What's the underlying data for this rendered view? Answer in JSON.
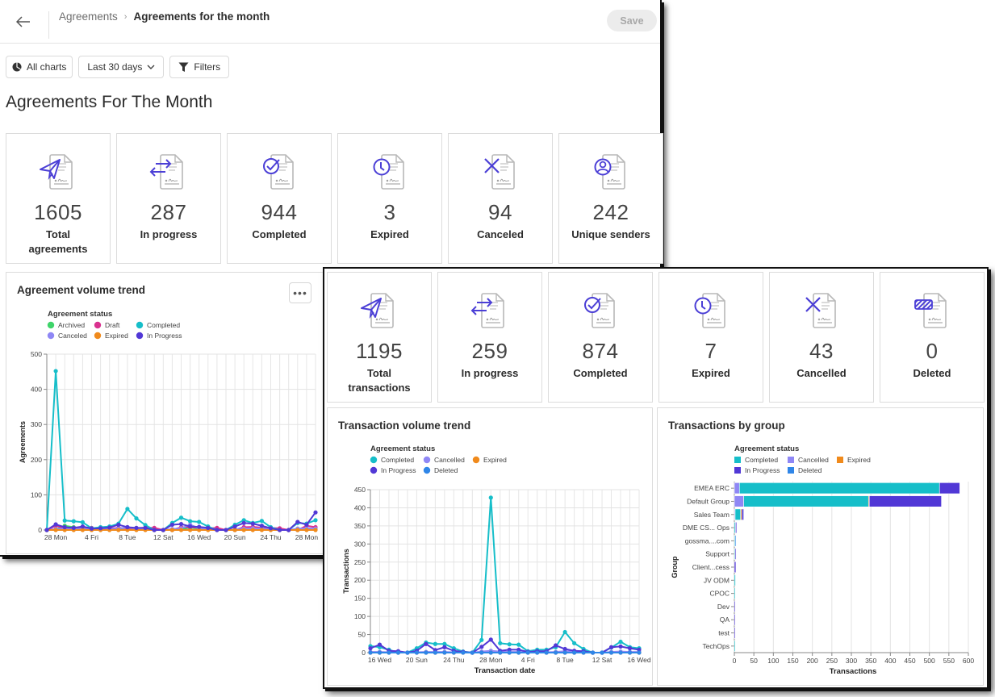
{
  "back_window": {
    "header": {
      "back_icon": "arrow-left-icon",
      "breadcrumb": {
        "parent": "Agreements",
        "separator": ">",
        "current": "Agreements for the month"
      },
      "save_label": "Save"
    },
    "toolbar": {
      "all_charts_label": "All charts",
      "all_charts_icon": "pie-chart-icon",
      "date_range": "Last 30 days",
      "filters_label": "Filters",
      "filters_icon": "funnel-icon"
    },
    "page_title": "Agreements For The Month",
    "stats": [
      {
        "icon": "paper-plane",
        "value": "1605",
        "label": "Total agreements"
      },
      {
        "icon": "arrows-exchange",
        "value": "287",
        "label": "In progress"
      },
      {
        "icon": "check-circle",
        "value": "944",
        "label": "Completed"
      },
      {
        "icon": "clock",
        "value": "3",
        "label": "Expired"
      },
      {
        "icon": "x-mark",
        "value": "94",
        "label": "Canceled"
      },
      {
        "icon": "user-circle",
        "value": "242",
        "label": "Unique senders"
      }
    ],
    "volume_trend": {
      "title": "Agreement volume trend",
      "more_label": "•••"
    }
  },
  "front_window": {
    "stats": [
      {
        "icon": "paper-plane",
        "value": "1195",
        "label": "Total transactions"
      },
      {
        "icon": "arrows-exchange",
        "value": "259",
        "label": "In progress"
      },
      {
        "icon": "check-circle",
        "value": "874",
        "label": "Completed"
      },
      {
        "icon": "clock",
        "value": "7",
        "label": "Expired"
      },
      {
        "icon": "x-mark",
        "value": "43",
        "label": "Cancelled"
      },
      {
        "icon": "striped-tag",
        "value": "0",
        "label": "Deleted"
      }
    ],
    "transaction_trend": {
      "title": "Transaction volume trend"
    },
    "by_group": {
      "title": "Transactions by group"
    }
  },
  "colors": {
    "accent_icon": "#4b3fd6",
    "completed": "#16bec9",
    "archived": "#3fd46a",
    "draft": "#d9318f",
    "canceled": "#8f87f5",
    "expired": "#f08a1c",
    "in_progress": "#5138d6",
    "deleted": "#2f86e8"
  },
  "chart_data": [
    {
      "id": "agreement-volume-trend",
      "type": "line",
      "title": "Agreement volume trend",
      "legend_title": "Agreement status",
      "legend_position": "top-left",
      "xlabel": "",
      "ylabel": "Agreements",
      "ylim": [
        0,
        500
      ],
      "yticks": [
        0,
        100,
        200,
        300,
        400,
        500
      ],
      "grid": true,
      "x_tick_labels": [
        {
          "index": 1,
          "label": "28 Mon"
        },
        {
          "index": 5,
          "label": "4 Fri"
        },
        {
          "index": 9,
          "label": "8 Tue"
        },
        {
          "index": 13,
          "label": "12 Sat"
        },
        {
          "index": 17,
          "label": "16 Wed"
        },
        {
          "index": 21,
          "label": "20 Sun"
        },
        {
          "index": 25,
          "label": "24 Thu"
        },
        {
          "index": 29,
          "label": "28 Mon"
        }
      ],
      "n_points": 31,
      "series": [
        {
          "name": "Archived",
          "color_key": "archived",
          "values": [
            0,
            2,
            12,
            8,
            5,
            3,
            2,
            3,
            4,
            6,
            4,
            5,
            3,
            0,
            0,
            3,
            6,
            4,
            3,
            3,
            0,
            0,
            3,
            4,
            3,
            4,
            3,
            0,
            0,
            3,
            2
          ]
        },
        {
          "name": "Draft",
          "color_key": "draft",
          "values": [
            0,
            12,
            5,
            6,
            8,
            6,
            4,
            4,
            6,
            5,
            5,
            7,
            6,
            0,
            0,
            8,
            8,
            6,
            5,
            6,
            0,
            0,
            8,
            9,
            7,
            6,
            5,
            0,
            0,
            12,
            8
          ]
        },
        {
          "name": "Completed",
          "color_key": "completed",
          "values": [
            0,
            452,
            27,
            25,
            22,
            5,
            8,
            10,
            18,
            60,
            33,
            14,
            0,
            0,
            20,
            35,
            25,
            23,
            10,
            0,
            0,
            15,
            28,
            20,
            26,
            8,
            0,
            0,
            20,
            18,
            28
          ]
        },
        {
          "name": "Canceled",
          "color_key": "canceled",
          "values": [
            0,
            3,
            4,
            3,
            3,
            2,
            3,
            3,
            4,
            8,
            4,
            3,
            0,
            0,
            3,
            5,
            15,
            5,
            3,
            0,
            0,
            2,
            4,
            5,
            4,
            2,
            0,
            0,
            4,
            5,
            4
          ]
        },
        {
          "name": "Expired",
          "color_key": "expired",
          "values": [
            0,
            0,
            0,
            0,
            0,
            0,
            0,
            0,
            0,
            0,
            0,
            0,
            0,
            0,
            0,
            0,
            0,
            0,
            0,
            0,
            0,
            0,
            0,
            0,
            0,
            0,
            0,
            0,
            0,
            0,
            0
          ]
        },
        {
          "name": "In Progress",
          "color_key": "in_progress",
          "values": [
            0,
            16,
            8,
            6,
            10,
            4,
            5,
            7,
            15,
            8,
            6,
            6,
            0,
            0,
            15,
            17,
            10,
            9,
            6,
            0,
            0,
            10,
            20,
            18,
            12,
            5,
            0,
            0,
            23,
            15,
            50
          ]
        }
      ]
    },
    {
      "id": "transaction-volume-trend",
      "type": "line",
      "title": "Transaction volume trend",
      "legend_title": "Agreement status",
      "legend_position": "top-left",
      "xlabel": "Transaction date",
      "ylabel": "Transactions",
      "ylim": [
        0,
        450
      ],
      "yticks": [
        0,
        50,
        100,
        150,
        200,
        250,
        300,
        350,
        400,
        450
      ],
      "grid": true,
      "x_tick_labels": [
        {
          "index": 1,
          "label": "16 Wed"
        },
        {
          "index": 5,
          "label": "20 Sun"
        },
        {
          "index": 9,
          "label": "24 Thu"
        },
        {
          "index": 13,
          "label": "28 Mon"
        },
        {
          "index": 17,
          "label": "4 Fri"
        },
        {
          "index": 21,
          "label": "8 Tue"
        },
        {
          "index": 25,
          "label": "12 Sat"
        },
        {
          "index": 29,
          "label": "16 Wed"
        }
      ],
      "n_points": 30,
      "series": [
        {
          "name": "Completed",
          "color_key": "completed",
          "values": [
            18,
            15,
            8,
            0,
            0,
            12,
            28,
            24,
            24,
            12,
            3,
            0,
            35,
            428,
            26,
            23,
            22,
            4,
            8,
            8,
            15,
            57,
            26,
            10,
            0,
            0,
            14,
            30,
            15,
            12
          ]
        },
        {
          "name": "Cancelled",
          "color_key": "canceled",
          "values": [
            2,
            2,
            1,
            1,
            0,
            1,
            2,
            2,
            2,
            1,
            1,
            0,
            3,
            5,
            3,
            2,
            2,
            1,
            1,
            1,
            2,
            4,
            3,
            1,
            0,
            0,
            2,
            3,
            2,
            2
          ]
        },
        {
          "name": "Expired",
          "color_key": "expired",
          "values": [
            0,
            0,
            0,
            0,
            0,
            0,
            0,
            0,
            0,
            0,
            0,
            0,
            0,
            0,
            0,
            0,
            0,
            0,
            0,
            0,
            0,
            0,
            0,
            0,
            0,
            0,
            0,
            0,
            0,
            0
          ]
        },
        {
          "name": "In Progress",
          "color_key": "in_progress",
          "values": [
            12,
            22,
            5,
            4,
            0,
            5,
            24,
            7,
            15,
            5,
            2,
            0,
            16,
            36,
            5,
            8,
            8,
            2,
            4,
            4,
            20,
            10,
            5,
            4,
            0,
            0,
            15,
            17,
            12,
            8
          ]
        },
        {
          "name": "Deleted",
          "color_key": "deleted",
          "values": [
            0,
            0,
            0,
            0,
            0,
            0,
            0,
            0,
            0,
            0,
            0,
            0,
            0,
            0,
            0,
            0,
            0,
            0,
            0,
            0,
            0,
            0,
            0,
            0,
            0,
            0,
            0,
            0,
            0,
            0
          ]
        }
      ]
    },
    {
      "id": "transactions-by-group",
      "type": "bar",
      "orientation": "horizontal",
      "stacked": true,
      "title": "Transactions by group",
      "legend_title": "Agreement status",
      "legend_position": "top-left",
      "xlabel": "Transactions",
      "ylabel": "Group",
      "xlim": [
        0,
        600
      ],
      "xticks": [
        0,
        50,
        100,
        150,
        200,
        250,
        300,
        350,
        400,
        450,
        500,
        550,
        600
      ],
      "grid": true,
      "categories": [
        "EMEA ERC",
        "Default Group",
        "Sales Team",
        "DME CS... Ops",
        "gossma....com",
        "Support",
        "Client...cess",
        "JV ODM",
        "CPOC",
        "Dev",
        "QA",
        "test",
        "TechOps"
      ],
      "series": [
        {
          "name": "Cancelled",
          "color_key": "canceled",
          "values": [
            13,
            24,
            2,
            0,
            0,
            0,
            0,
            0,
            0,
            0,
            0,
            0,
            0
          ]
        },
        {
          "name": "Completed",
          "color_key": "completed",
          "values": [
            513,
            320,
            14,
            3,
            2,
            2,
            0,
            3,
            2,
            0,
            0,
            0,
            1
          ]
        },
        {
          "name": "Expired",
          "color_key": "expired",
          "values": [
            0,
            2,
            3,
            0,
            0,
            0,
            0,
            0,
            0,
            0,
            0,
            0,
            0
          ]
        },
        {
          "name": "In Progress",
          "color_key": "in_progress",
          "values": [
            52,
            185,
            5,
            3,
            0,
            1,
            4,
            0,
            0,
            1,
            1,
            1,
            0
          ]
        },
        {
          "name": "Deleted",
          "color_key": "deleted",
          "values": [
            0,
            0,
            0,
            0,
            2,
            0,
            0,
            0,
            0,
            0,
            0,
            0,
            0
          ]
        }
      ],
      "legend_order": [
        "Completed",
        "Cancelled",
        "Expired",
        "In Progress",
        "Deleted"
      ]
    }
  ]
}
